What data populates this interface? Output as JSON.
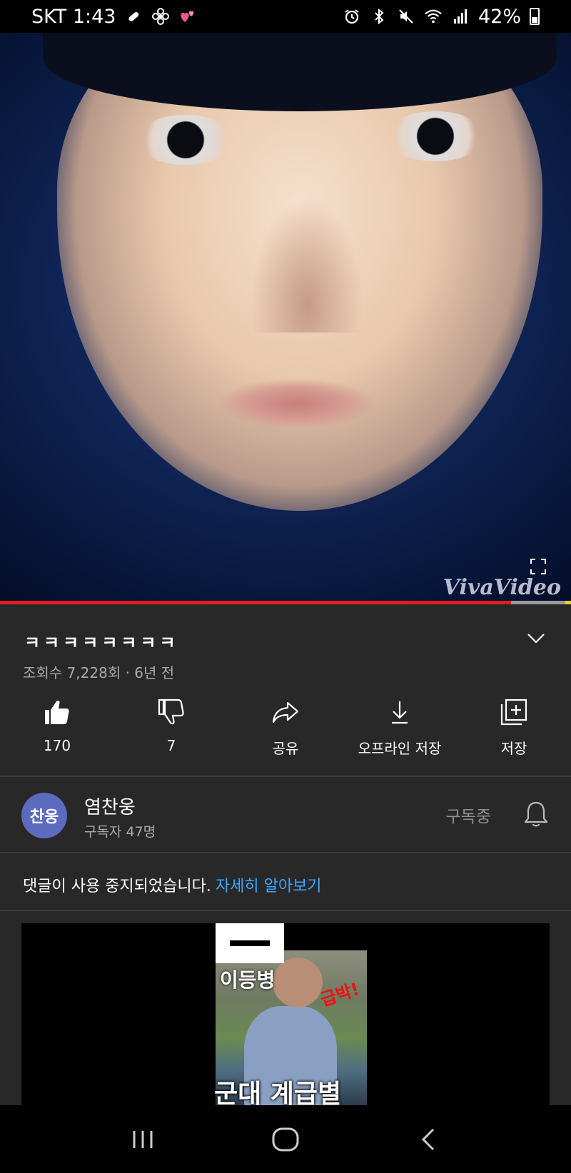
{
  "status_bar": {
    "carrier_time": "SKT 1:43",
    "battery": "42%",
    "left_icons": [
      "pill-icon",
      "fan-icon",
      "hearts-icon"
    ],
    "right_icons": [
      "alarm-icon",
      "bluetooth-icon",
      "mute-icon",
      "wifi-icon",
      "signal-icon",
      "battery-icon"
    ]
  },
  "video": {
    "watermark": "VivaVideo",
    "progress": 0.895
  },
  "info": {
    "title": "ㅋㅋㅋㅋㅋㅋㅋㅋ",
    "meta": "조회수 7,228회 · 6년 전",
    "actions": [
      {
        "icon": "thumbs-up-icon",
        "label": "170"
      },
      {
        "icon": "thumbs-down-icon",
        "label": "7"
      },
      {
        "icon": "share-icon",
        "label": "공유"
      },
      {
        "icon": "download-icon",
        "label": "오프라인 저장"
      },
      {
        "icon": "save-playlist-icon",
        "label": "저장"
      }
    ]
  },
  "channel": {
    "avatar_text": "찬웅",
    "name": "염찬웅",
    "subscribers": "구독자 47명",
    "subscribed_label": "구독중"
  },
  "comments": {
    "disabled_text": "댓글이 사용 중지되었습니다.",
    "learn_more": "자세히 알아보기"
  },
  "recommended": {
    "rank_label": "이등병",
    "urgent_label": "급박!",
    "caption": "군대 계급별"
  },
  "colors": {
    "background": "#282828",
    "progress_played": "#e21d1d",
    "link": "#3ea6ff",
    "avatar": "#5c6bc0"
  }
}
